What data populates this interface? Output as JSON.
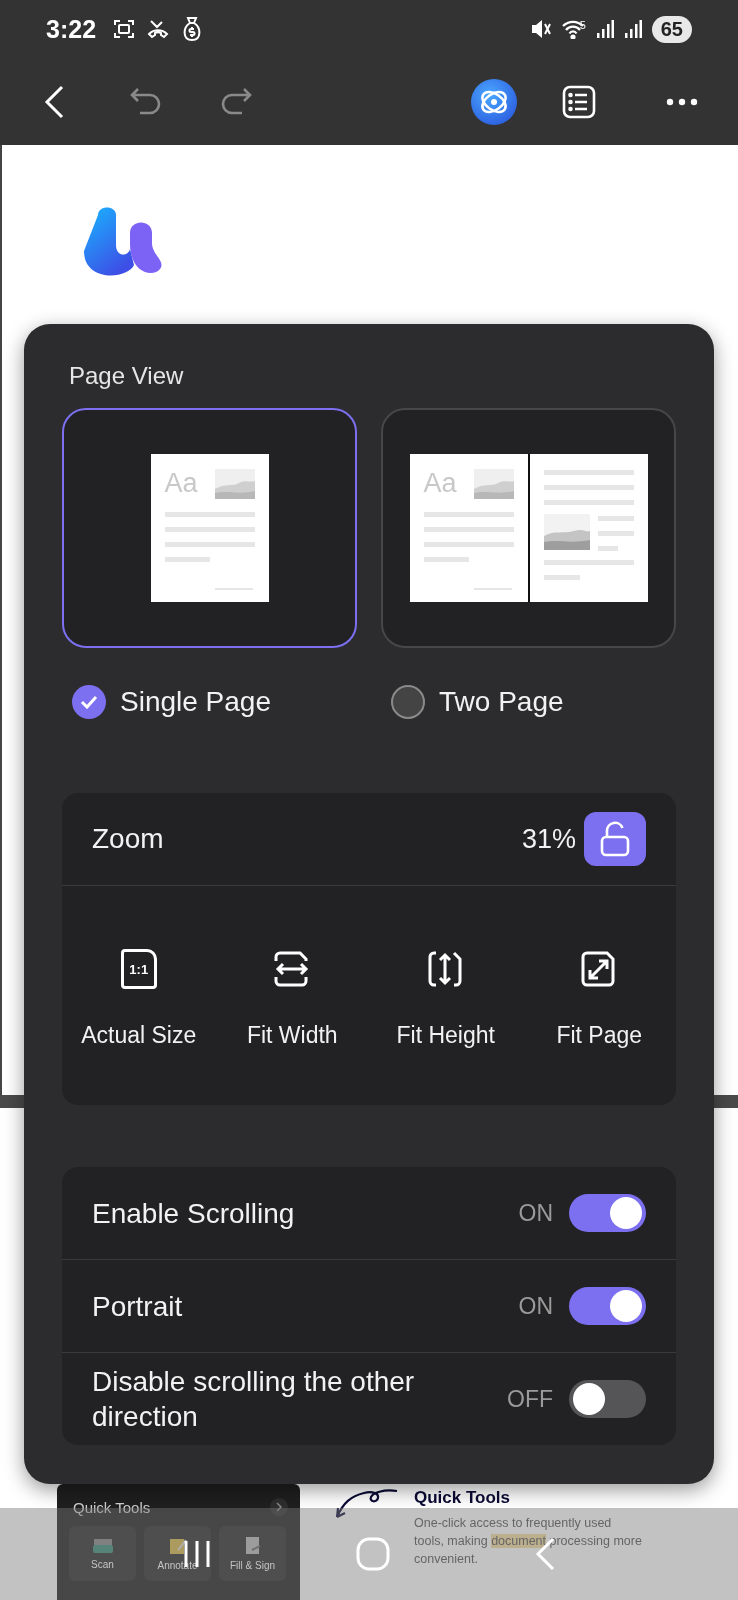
{
  "status_bar": {
    "time": "3:22",
    "wifi_label": "5",
    "battery": "65"
  },
  "toolbar": {
    "undo": {
      "disabled": true
    },
    "redo": {
      "disabled": true
    }
  },
  "document": {
    "quick_tools_card": {
      "title": "Quick Tools",
      "tools": [
        "Scan",
        "Annotate",
        "Fill & Sign"
      ]
    },
    "feature_title": "Quick Tools",
    "feature_text": {
      "before": "One-click access to frequently used tools, making ",
      "highlight": "document",
      "after": " processing more convenient."
    }
  },
  "page_view": {
    "title": "Page View",
    "options": [
      {
        "kind": "single",
        "label": "Single Page",
        "selected": true,
        "sample_text": [
          "Aa"
        ]
      },
      {
        "kind": "two",
        "label": "Two Page",
        "selected": false,
        "sample_text": [
          "Aa"
        ]
      }
    ]
  },
  "zoom": {
    "label": "Zoom",
    "value": "31%",
    "locked": false,
    "actions": [
      {
        "kind": "actual",
        "label": "Actual Size",
        "icon_text": "1:1"
      },
      {
        "kind": "width",
        "label": "Fit Width"
      },
      {
        "kind": "height",
        "label": "Fit Height"
      },
      {
        "kind": "page",
        "label": "Fit Page"
      }
    ]
  },
  "settings": [
    {
      "label": "Enable Scrolling",
      "state": "ON",
      "on": true
    },
    {
      "label": "Portrait",
      "state": "ON",
      "on": true
    },
    {
      "label": "Disable scrolling the other direction",
      "state": "OFF",
      "on": false
    }
  ]
}
